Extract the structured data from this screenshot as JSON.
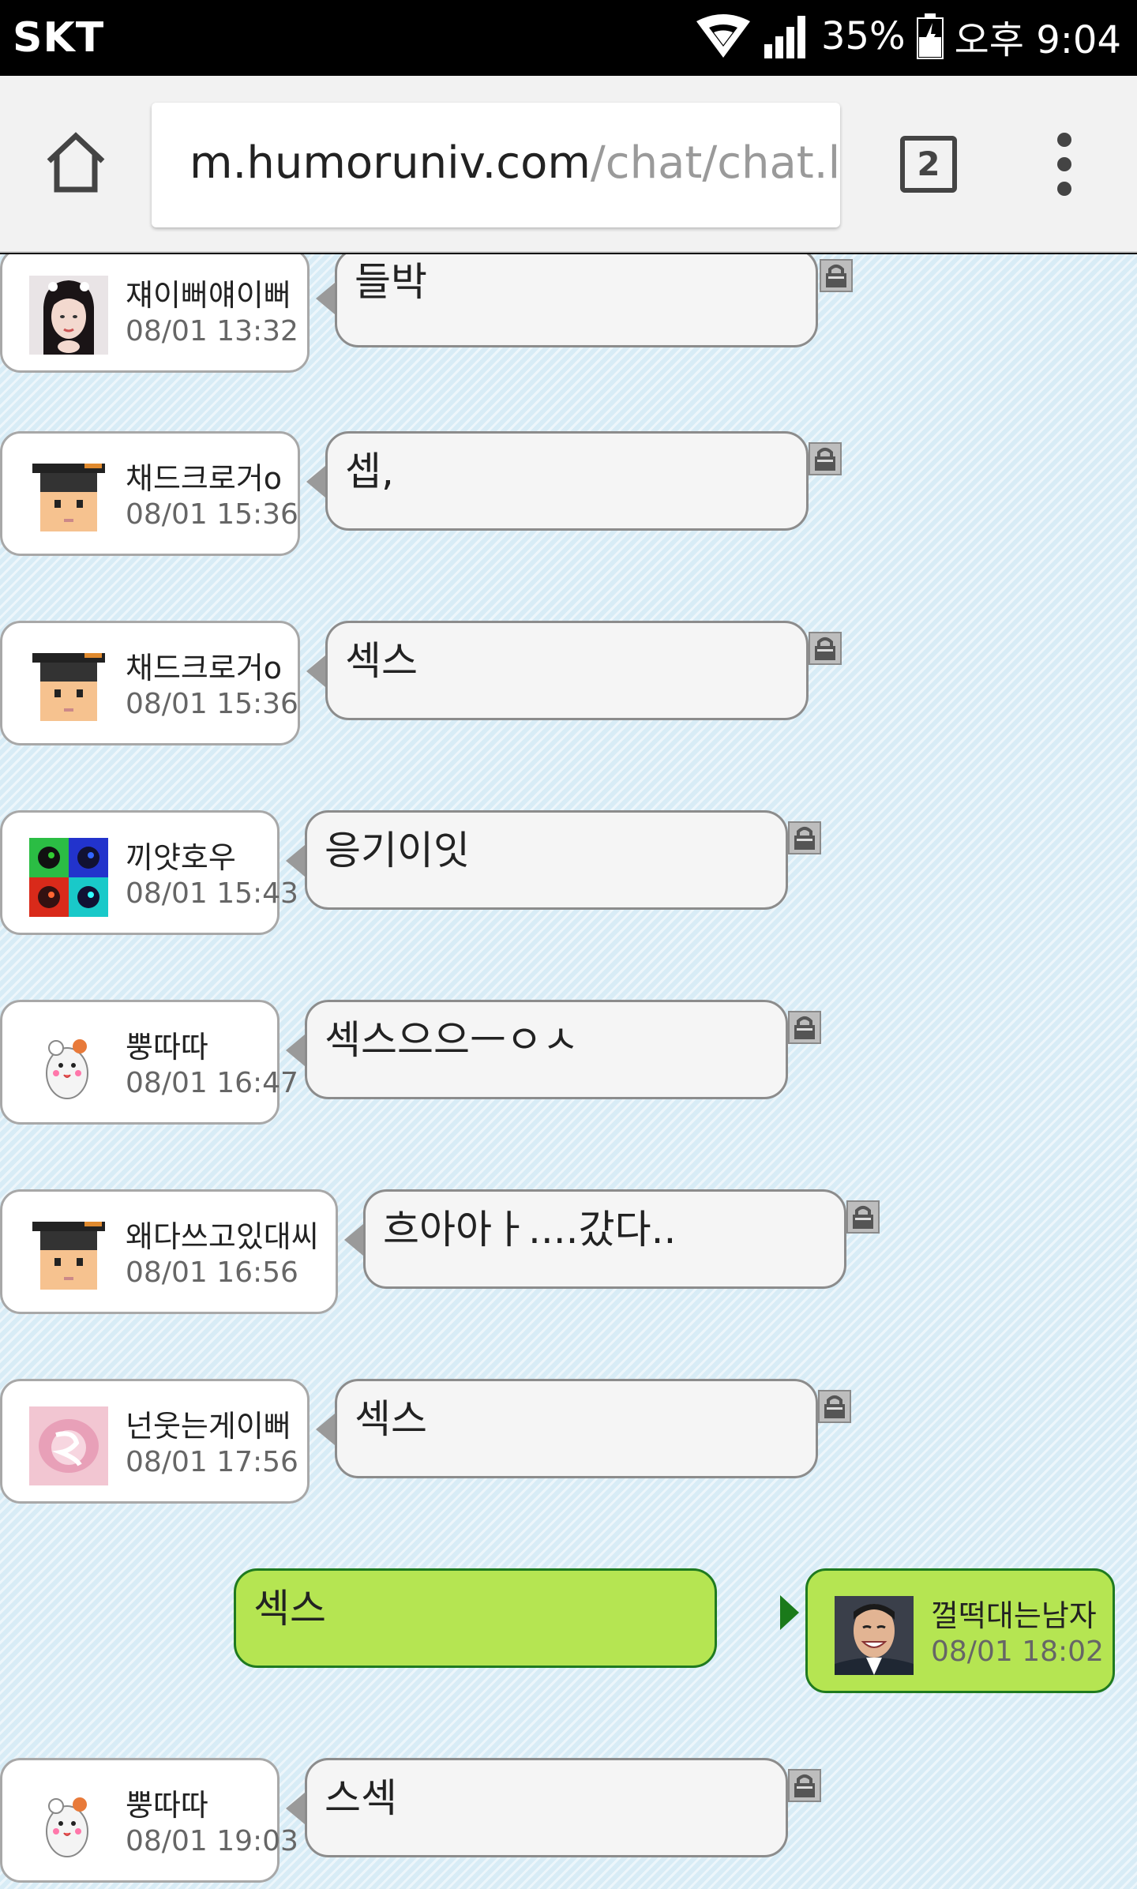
{
  "status_bar": {
    "carrier": "SKT",
    "battery": "35%",
    "time": "오후 9:04"
  },
  "browser": {
    "url_host": "m.humoruniv.com",
    "url_path": "/chat/chat.l",
    "tab_count": "2"
  },
  "messages": [
    {
      "nick": "쟤이뻐얘이뻐",
      "time": "08/01 13:32",
      "text": "들박",
      "avatar": "photo-girl-avatar"
    },
    {
      "nick": "채드크로거o",
      "time": "08/01 15:36",
      "text": "셉,",
      "avatar": "graduate-cap-avatar"
    },
    {
      "nick": "채드크로거o",
      "time": "08/01 15:36",
      "text": "섹스",
      "avatar": "graduate-cap-avatar"
    },
    {
      "nick": "끼얏호우",
      "time": "08/01 15:43",
      "text": "응기이잇",
      "avatar": "pop-art-avatar"
    },
    {
      "nick": "뿡따따",
      "time": "08/01 16:47",
      "text": "섹스으으ㅡㅇㅅ",
      "avatar": "hamster-avatar"
    },
    {
      "nick": "왜다쓰고있대씨",
      "time": "08/01 16:56",
      "text": "흐아아ㅏ....갔다..",
      "avatar": "graduate-cap-avatar"
    },
    {
      "nick": "넌웃는게이뻐",
      "time": "08/01 17:56",
      "text": "섹스",
      "avatar": "pink-blur-avatar"
    },
    {
      "nick": "껄떡대는남자",
      "time": "08/01 18:02",
      "text": "섹스",
      "avatar": "smiling-man-avatar",
      "mine": true
    },
    {
      "nick": "뿡따따",
      "time": "08/01 19:03",
      "text": "스섹",
      "avatar": "hamster-avatar"
    }
  ],
  "colors": {
    "chat_bg": "#d8ecf6",
    "bubble_bg": "#f5f5f5",
    "mine_bg": "#b5e552",
    "mine_border": "#1f7a1f"
  }
}
